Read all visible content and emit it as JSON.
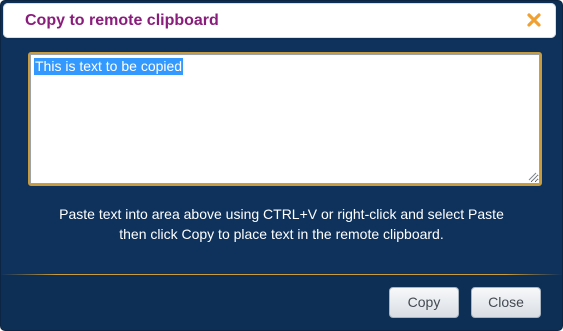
{
  "dialog": {
    "title": "Copy to remote clipboard",
    "close_icon": "close-icon",
    "textarea_value": "This is text to be copied",
    "instructions_line1": "Paste text into area above using CTRL+V or right-click and select Paste",
    "instructions_line2": "then click Copy to place text in the remote clipboard.",
    "copy_label": "Copy",
    "close_label": "Close"
  },
  "colors": {
    "title": "#8a1c7c",
    "close_icon": "#f0a030",
    "background": "#0d2f55",
    "accent_border": "#c89b3c",
    "selection": "#3399ff"
  }
}
